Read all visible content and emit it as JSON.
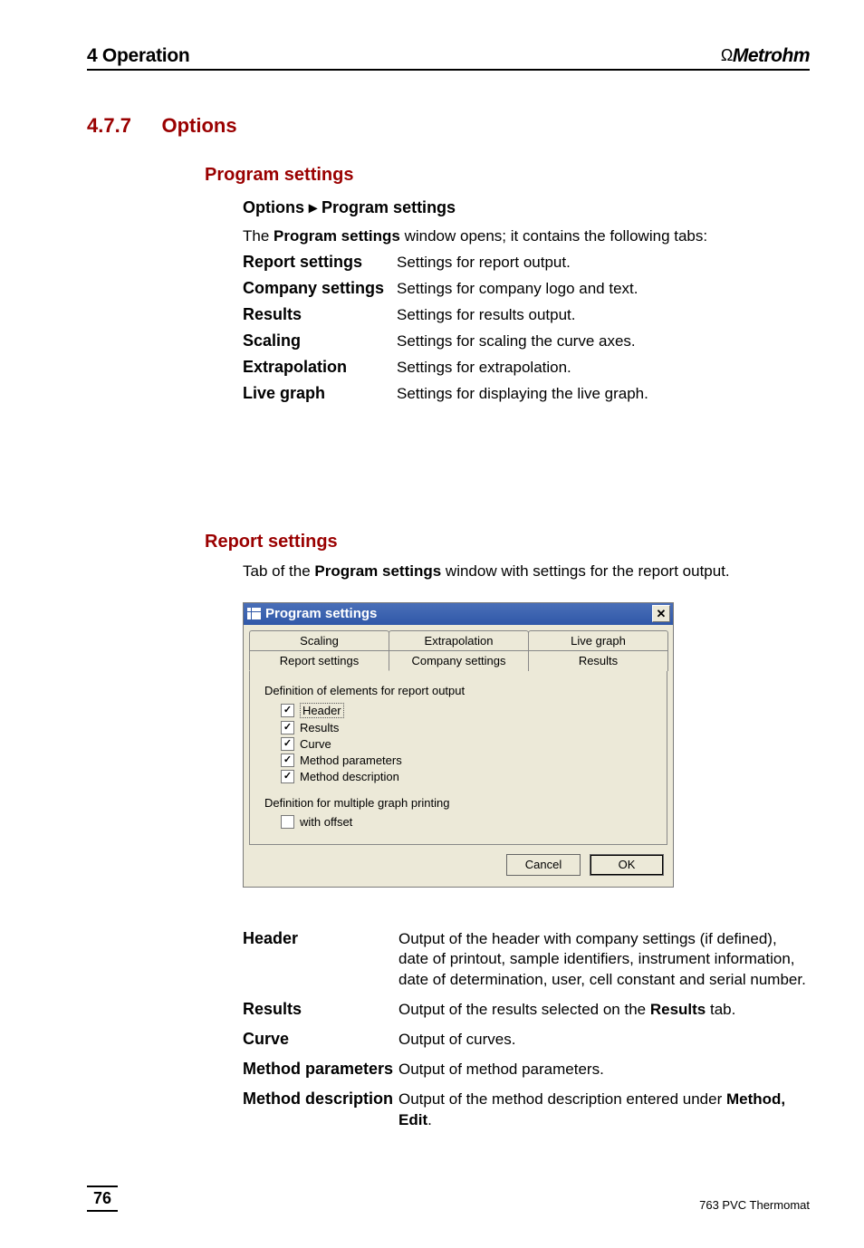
{
  "header": {
    "left": "4 Operation",
    "brand_symbol": "Ω",
    "brand_name": "Metrohm"
  },
  "section": {
    "number": "4.7.7",
    "title": "Options",
    "program_settings_heading": "Program settings",
    "menu_path": "Options ▸ Program settings",
    "intro_prefix": "The ",
    "intro_bold": "Program settings",
    "intro_suffix": " window opens; it contains the following tabs:",
    "tabs": [
      {
        "name": "Report settings",
        "desc": "Settings for report output."
      },
      {
        "name": "Company settings",
        "desc": "Settings for company logo and text."
      },
      {
        "name": "Results",
        "desc": "Settings for results output."
      },
      {
        "name": "Scaling",
        "desc": "Settings for scaling the curve axes."
      },
      {
        "name": "Extrapolation",
        "desc": "Settings for extrapolation."
      },
      {
        "name": "Live graph",
        "desc": "Settings for displaying the live graph."
      }
    ]
  },
  "report": {
    "heading": "Report settings",
    "intro_prefix": "Tab of the ",
    "intro_bold": "Program settings",
    "intro_suffix": " window with settings for the report output."
  },
  "dialog": {
    "title": "Program settings",
    "close_glyph": "✕",
    "tabs_row1": [
      "Scaling",
      "Extrapolation",
      "Live graph"
    ],
    "tabs_row2": [
      "Report settings",
      "Company settings",
      "Results"
    ],
    "selected_tab": "Report settings",
    "group1_label": "Definition of elements for report output",
    "checks1": [
      {
        "label": "Header",
        "checked": true,
        "focused": true
      },
      {
        "label": "Results",
        "checked": true,
        "focused": false
      },
      {
        "label": "Curve",
        "checked": true,
        "focused": false
      },
      {
        "label": "Method parameters",
        "checked": true,
        "focused": false
      },
      {
        "label": "Method description",
        "checked": true,
        "focused": false
      }
    ],
    "group2_label": "Definition for multiple graph printing",
    "checks2": [
      {
        "label": "with offset",
        "checked": false
      }
    ],
    "buttons": {
      "cancel": "Cancel",
      "ok": "OK"
    }
  },
  "fields": [
    {
      "name": "Header",
      "desc": "Output of the header with company settings (if defined), date of printout, sample identifiers, instrument information, date of determination, user, cell constant and serial number."
    },
    {
      "name": "Results",
      "desc_pre": "Output of the results selected on the ",
      "desc_bold": "Results",
      "desc_post": " tab."
    },
    {
      "name": "Curve",
      "desc": "Output of curves."
    },
    {
      "name": "Method parameters",
      "desc": "Output of method parameters."
    },
    {
      "name": "Method description",
      "desc_pre": "Output of the method description entered under ",
      "desc_bold": "Method, Edit",
      "desc_post": "."
    }
  ],
  "footer": {
    "page": "76",
    "product": "763 PVC Thermomat"
  }
}
